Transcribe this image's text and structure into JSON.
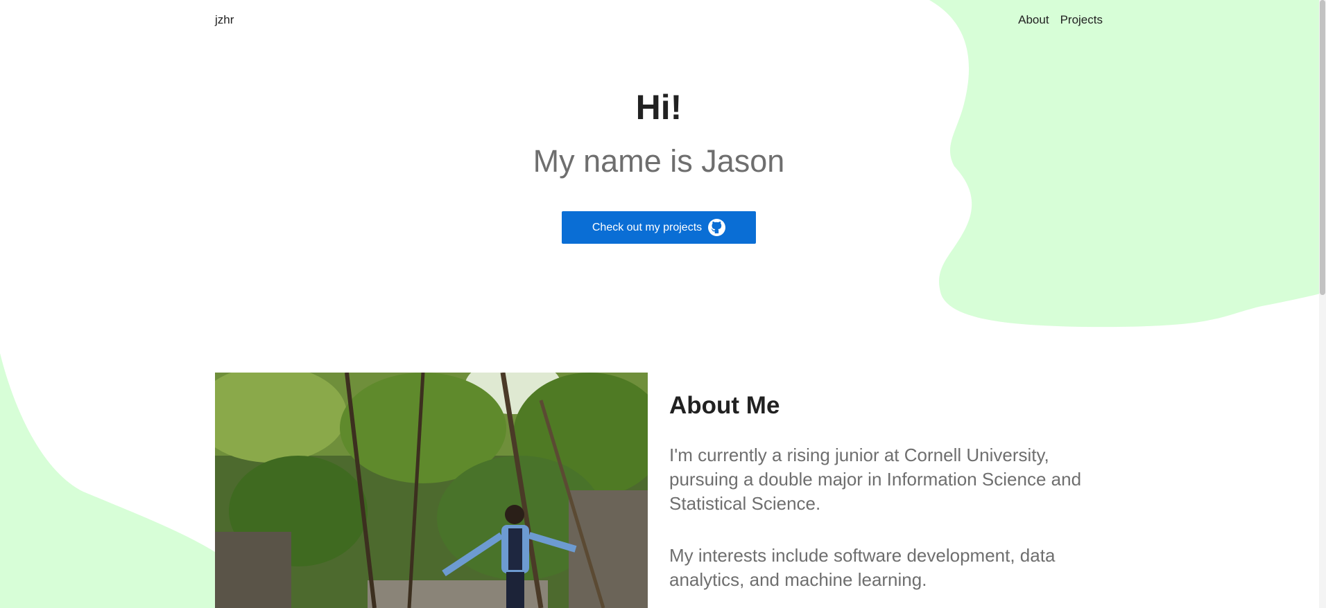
{
  "colors": {
    "blob": "#d7fed7",
    "accent": "#0a6ed5",
    "text_dark": "#212121",
    "text_muted": "#6e6e6e"
  },
  "navbar": {
    "brand": "jzhr",
    "links": [
      {
        "label": "About"
      },
      {
        "label": "Projects"
      }
    ]
  },
  "hero": {
    "title": "Hi!",
    "subtitle": "My name is Jason",
    "cta_label": "Check out my projects",
    "cta_icon": "github-icon"
  },
  "about": {
    "heading": "About Me",
    "paragraphs": [
      "I'm currently a rising junior at Cornell University, pursuing a double major in Information Science and Statistical Science.",
      "My interests include software development, data analytics, and machine learning."
    ],
    "photo_icon": "profile-photo"
  }
}
